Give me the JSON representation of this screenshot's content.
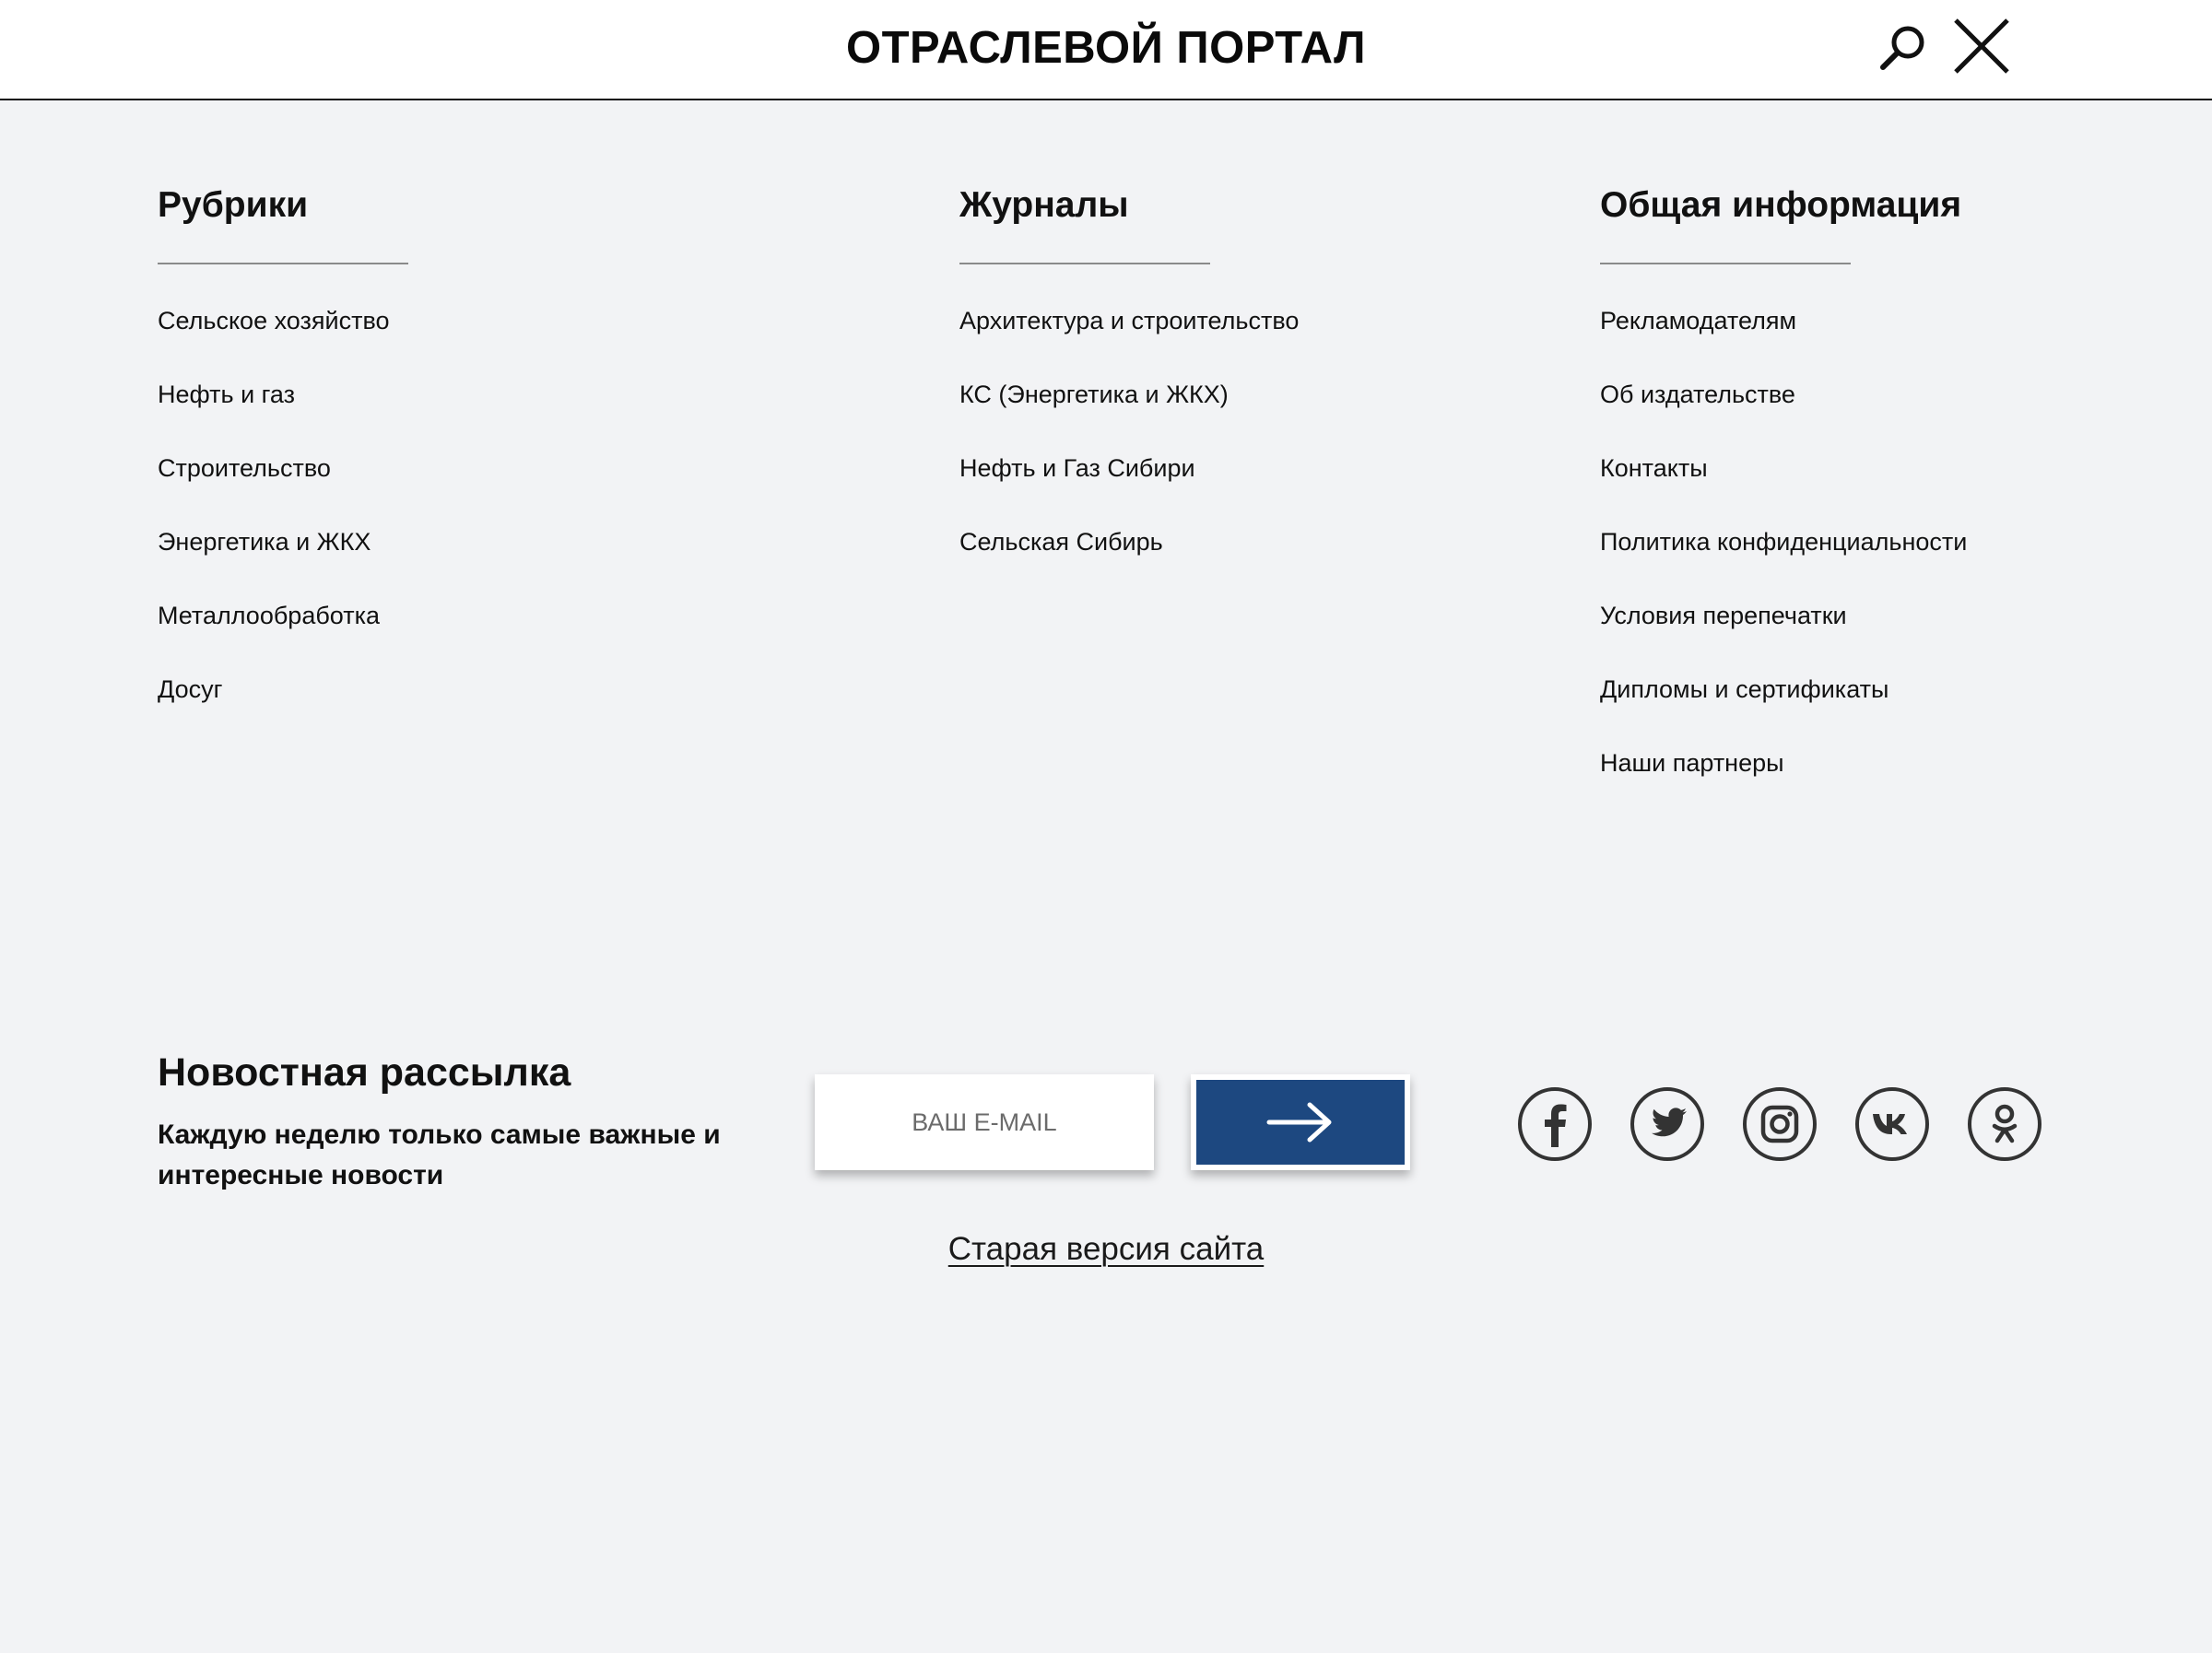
{
  "header": {
    "title": "ОТРАСЛЕВОЙ ПОРТАЛ",
    "search_icon": "search-icon",
    "close_icon": "close-icon"
  },
  "columns": [
    {
      "heading": "Рубрики",
      "items": [
        "Сельское хозяйство",
        "Нефть и газ",
        "Строительство",
        "Энергетика и ЖКХ",
        "Металлообработка",
        "Досуг"
      ]
    },
    {
      "heading": "Журналы",
      "items": [
        "Архитектура и строительство",
        "КС (Энергетика и ЖКХ)",
        "Нефть и Газ Сибири",
        "Сельская Сибирь"
      ]
    },
    {
      "heading": "Общая информация",
      "items": [
        "Рекламодателям",
        "Об издательстве",
        "Контакты",
        "Политика конфиденциальности",
        "Условия перепечатки",
        "Дипломы и сертификаты",
        "Наши партнеры"
      ]
    }
  ],
  "newsletter": {
    "title": "Новостная рассылка",
    "subtitle": "Каждую неделю только самые важные и интересные новости",
    "email_placeholder": "ВАШ E-MAIL",
    "email_value": "",
    "submit_icon": "arrow-right-icon"
  },
  "social": [
    {
      "name": "facebook",
      "icon": "facebook-icon"
    },
    {
      "name": "twitter",
      "icon": "twitter-icon"
    },
    {
      "name": "instagram",
      "icon": "instagram-icon"
    },
    {
      "name": "vk",
      "icon": "vk-icon"
    },
    {
      "name": "odnoklassniki",
      "icon": "odnoklassniki-icon"
    }
  ],
  "footer": {
    "old_version_link": "Старая версия сайта"
  },
  "colors": {
    "background": "#f2f3f5",
    "header_background": "#ffffff",
    "accent": "#1d4880",
    "text": "#111111"
  }
}
